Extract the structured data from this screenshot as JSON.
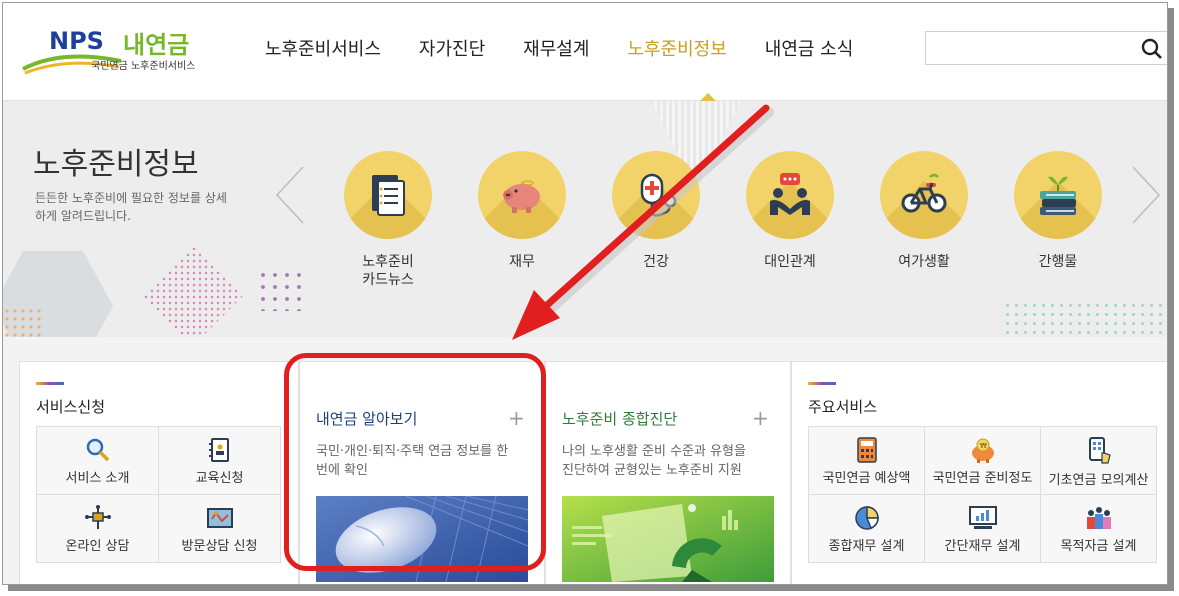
{
  "header": {
    "logo": {
      "nps": "NPS",
      "brand": "내연금",
      "subtitle": "국민연금 노후준비서비스"
    },
    "nav": [
      {
        "label": "노후준비서비스",
        "active": false
      },
      {
        "label": "자가진단",
        "active": false
      },
      {
        "label": "재무설계",
        "active": false
      },
      {
        "label": "노후준비정보",
        "active": true
      },
      {
        "label": "내연금 소식",
        "active": false
      }
    ],
    "search": {
      "placeholder": "",
      "icon": "search-icon"
    }
  },
  "banner": {
    "title": "노후준비정보",
    "description": "든든한 노후준비에 필요한 정보를 상세하게 알려드립니다.",
    "categories": [
      {
        "label": "노후준비\n카드뉴스",
        "icon": "cardnews-icon"
      },
      {
        "label": "재무",
        "icon": "piggy-bank-icon"
      },
      {
        "label": "건강",
        "icon": "stethoscope-icon"
      },
      {
        "label": "대인관계",
        "icon": "people-icon"
      },
      {
        "label": "여가생활",
        "icon": "bicycle-icon"
      },
      {
        "label": "간행물",
        "icon": "books-icon"
      }
    ]
  },
  "panels": {
    "service_apply": {
      "title": "서비스신청",
      "items": [
        {
          "label": "서비스 소개",
          "icon": "magnifier-icon"
        },
        {
          "label": "교육신청",
          "icon": "notebook-icon"
        },
        {
          "label": "온라인 상담",
          "icon": "network-icon"
        },
        {
          "label": "방문상담 신청",
          "icon": "map-icon"
        }
      ]
    },
    "pension_overview": {
      "title": "내연금 알아보기",
      "plus": "+",
      "description": "국민·개인·퇴직·주택 연금 정보를 한 번에 확인"
    },
    "retirement_diagnosis": {
      "title": "노후준비 종합진단",
      "plus": "+",
      "description": "나의 노후생활 준비 수준과 유형을 진단하여 균형있는 노후준비 지원"
    },
    "main_services": {
      "title": "주요서비스",
      "items": [
        {
          "label": "국민연금 예상액",
          "icon": "calculator-icon"
        },
        {
          "label": "국민연금 준비정도",
          "icon": "piggy-coin-icon"
        },
        {
          "label": "기초연금 모의계산",
          "icon": "phone-touch-icon"
        },
        {
          "label": "종합재무 설계",
          "icon": "pie-chart-icon"
        },
        {
          "label": "간단재무 설계",
          "icon": "monitor-chart-icon"
        },
        {
          "label": "목적자금 설계",
          "icon": "people-group-icon"
        }
      ]
    }
  },
  "colors": {
    "accent_gold": "#c7a020",
    "circle_yellow": "#f2d36a",
    "highlight_red": "#e21f1f",
    "brand_blue": "#1f3f9c",
    "brand_green": "#76b82a"
  }
}
